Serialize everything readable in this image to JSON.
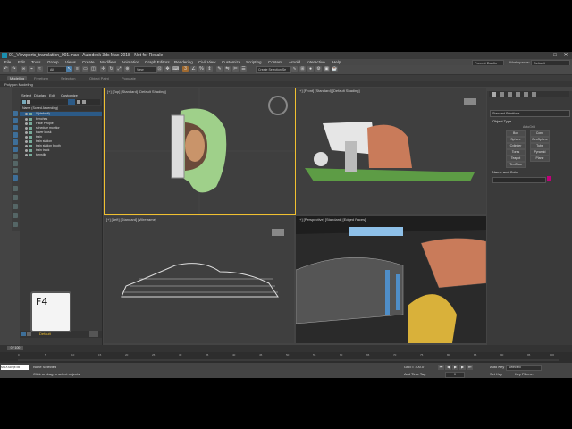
{
  "window": {
    "title": "01_Viewports_translation_001.max - Autodesk 3ds Max 2018 - Not for Resale",
    "minimize": "—",
    "maximize": "□",
    "close": "✕"
  },
  "menu": {
    "items": [
      "File",
      "Edit",
      "Tools",
      "Group",
      "Views",
      "Create",
      "Modifiers",
      "Animation",
      "Graph Editors",
      "Rendering",
      "Civil View",
      "Customize",
      "Scripting",
      "Content",
      "Arnold",
      "Interactive",
      "Help"
    ],
    "user": "Forrest Dahlin",
    "workspaces_label": "Workspaces:",
    "workspace": "Default"
  },
  "toolbar": {
    "filter": "All",
    "view": "View",
    "selection_set": "Create Selection Se"
  },
  "ribbon": {
    "tabs": [
      "Modeling",
      "Freeform",
      "Selection",
      "Object Paint",
      "Populate"
    ],
    "panel": "Polygon Modeling"
  },
  "scene": {
    "tabs": [
      "Select",
      "Display",
      "Edit",
      "Customize"
    ],
    "header": "Name (Sorted Ascending)",
    "rows": [
      "0 (default)",
      "benches",
      "Fake People",
      "schedule monitor",
      "tower kiosk",
      "train",
      "train station",
      "train station booth",
      "train track",
      "turnstile"
    ]
  },
  "viewports": {
    "top": "[+] [Top] [Standard] [Default Shading]",
    "front": "[+] [Front] [Standard] [Default Shading]",
    "left": "[+] [Left] [Standard] [Wireframe]",
    "perspective": "[+] [Perspective] [Standard] [Edged Faces]"
  },
  "keycap": "F4",
  "command_panel": {
    "dropdown": "Standard Primitives",
    "rollout_object_type": "Object Type",
    "autogrid": "AutoGrid",
    "buttons": [
      "Box",
      "Cone",
      "Sphere",
      "GeoSphere",
      "Cylinder",
      "Tube",
      "Torus",
      "Pyramid",
      "Teapot",
      "Plane",
      "TextPlus"
    ],
    "rollout_name_color": "Name and Color",
    "swatch_color": "#c0007a"
  },
  "layer": {
    "name": "Default"
  },
  "timeline": {
    "frame": "0 / 100",
    "ticks": [
      "0",
      "5",
      "10",
      "15",
      "20",
      "25",
      "30",
      "35",
      "40",
      "45",
      "50",
      "55",
      "60",
      "65",
      "70",
      "75",
      "80",
      "85",
      "90",
      "95",
      "100"
    ]
  },
  "status": {
    "maxscript": "MAXScript Mi",
    "selection": "None Selected",
    "prompt": "Click or drag to select objects",
    "grid": "Grid = 100.0\"",
    "add_time_tag": "Add Time Tag",
    "auto_key": "Auto Key",
    "set_key": "Set Key",
    "selected": "Selected",
    "key_filters": "Key Filters...",
    "frame_field": "0"
  },
  "colors": {
    "accent": "#2c5a86",
    "viewport_active_border": "#f0c030"
  }
}
